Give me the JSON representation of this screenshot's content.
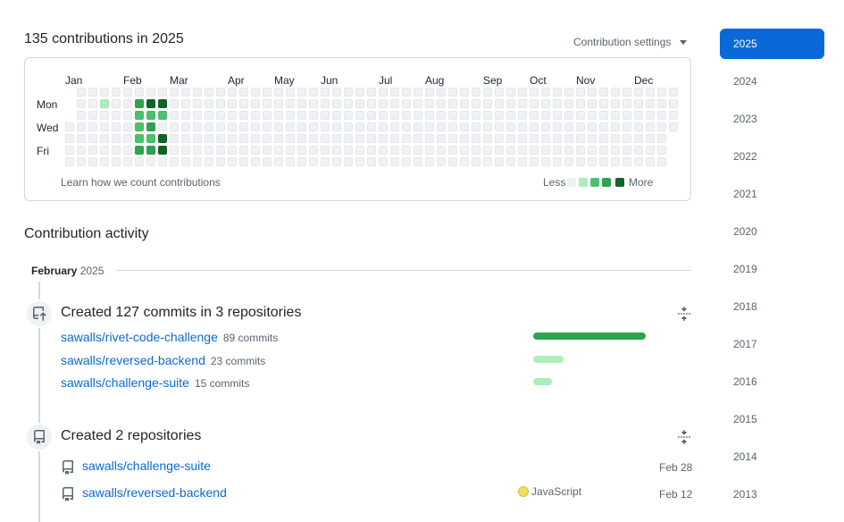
{
  "header": {
    "title": "135 contributions in 2025",
    "settings_label": "Contribution settings"
  },
  "calendar": {
    "months": [
      "Jan",
      "Feb",
      "Mar",
      "Apr",
      "May",
      "Jun",
      "Jul",
      "Aug",
      "Sep",
      "Oct",
      "Nov",
      "Dec"
    ],
    "day_labels": [
      "Mon",
      "Wed",
      "Fri"
    ],
    "learn_label": "Learn how we count contributions",
    "legend_less": "Less",
    "legend_more": "More",
    "colors": [
      "#eff2f5",
      "#aceebb",
      "#4ac26b",
      "#2da44e",
      "#116329"
    ],
    "active_cells": [
      {
        "week": 3,
        "day": 1,
        "level": 1
      },
      {
        "week": 6,
        "day": 1,
        "level": 3
      },
      {
        "week": 7,
        "day": 1,
        "level": 4
      },
      {
        "week": 6,
        "day": 2,
        "level": 2
      },
      {
        "week": 6,
        "day": 3,
        "level": 2
      },
      {
        "week": 6,
        "day": 4,
        "level": 2
      },
      {
        "week": 6,
        "day": 5,
        "level": 3
      },
      {
        "week": 7,
        "day": 2,
        "level": 2
      },
      {
        "week": 7,
        "day": 3,
        "level": 3
      },
      {
        "week": 7,
        "day": 4,
        "level": 2
      },
      {
        "week": 7,
        "day": 5,
        "level": 3
      },
      {
        "week": 8,
        "day": 1,
        "level": 4
      },
      {
        "week": 8,
        "day": 2,
        "level": 2
      },
      {
        "week": 8,
        "day": 4,
        "level": 4
      },
      {
        "week": 8,
        "day": 5,
        "level": 4
      }
    ]
  },
  "activity": {
    "title": "Contribution activity",
    "month": "February",
    "year": "2025",
    "commits_group": {
      "title": "Created 127 commits in 3 repositories",
      "repos": [
        {
          "name": "sawalls/rivet-code-challenge",
          "count": "89 commits",
          "share": 1.0,
          "color": "#2da44e"
        },
        {
          "name": "sawalls/reversed-backend",
          "count": "23 commits",
          "share": 0.27,
          "color": "#aceebb"
        },
        {
          "name": "sawalls/challenge-suite",
          "count": "15 commits",
          "share": 0.17,
          "color": "#aceebb"
        }
      ]
    },
    "repos_group": {
      "title": "Created 2 repositories",
      "repos": [
        {
          "name": "sawalls/challenge-suite",
          "language": "",
          "date": "Feb 28"
        },
        {
          "name": "sawalls/reversed-backend",
          "language": "JavaScript",
          "date": "Feb 12"
        }
      ]
    }
  },
  "years": [
    "2025",
    "2024",
    "2023",
    "2022",
    "2021",
    "2020",
    "2019",
    "2018",
    "2017",
    "2016",
    "2015",
    "2014",
    "2013"
  ],
  "icons": {
    "commit": "repo-push-icon",
    "repo": "repo-icon",
    "collapse": "fold-icon",
    "caret": "triangle-down-icon"
  }
}
